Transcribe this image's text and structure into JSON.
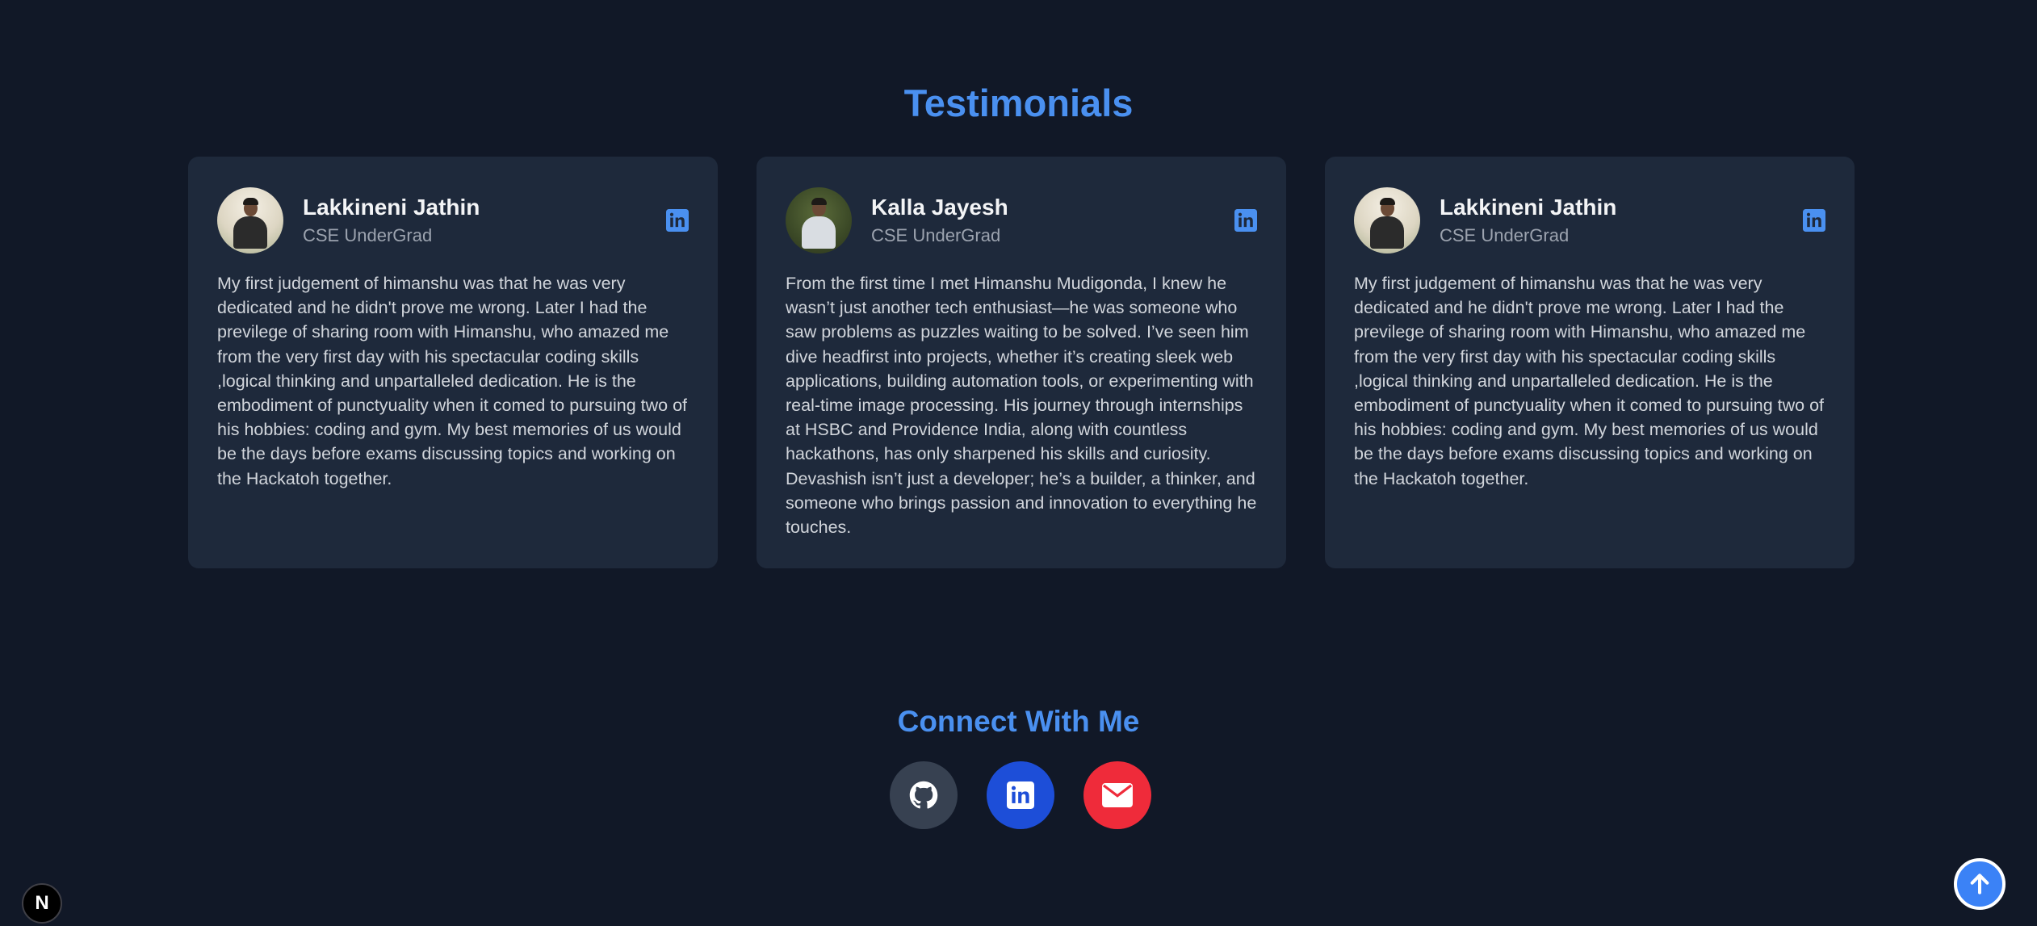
{
  "testimonials": {
    "title": "Testimonials",
    "cards": [
      {
        "name": "Lakkineni Jathin",
        "role": "CSE UnderGrad",
        "icon": "linkedin-icon",
        "text": "My first judgement of himanshu was that he was very dedicated and he didn't prove me wrong. Later I had the previlege of sharing room with Himanshu, who amazed me from the very first day with his spectacular coding skills ,logical thinking and unpartalleled dedication. He is the embodiment of punctyuality when it comed to pursuing two of his hobbies: coding and gym. My best memories of us would be the days before exams discussing topics and working on the Hackatoh together."
      },
      {
        "name": "Kalla Jayesh",
        "role": "CSE UnderGrad",
        "icon": "linkedin-icon",
        "text": "From the first time I met Himanshu Mudigonda, I knew he wasn’t just another tech enthusiast—he was someone who saw problems as puzzles waiting to be solved. I’ve seen him dive headfirst into projects, whether it’s creating sleek web applications, building automation tools, or experimenting with real-time image processing. His journey through internships at HSBC and Providence India, along with countless hackathons, has only sharpened his skills and curiosity. Devashish isn’t just a developer; he’s a builder, a thinker, and someone who brings passion and innovation to everything he touches."
      },
      {
        "name": "Lakkineni Jathin",
        "role": "CSE UnderGrad",
        "icon": "linkedin-icon",
        "text": "My first judgement of himanshu was that he was very dedicated and he didn't prove me wrong. Later I had the previlege of sharing room with Himanshu, who amazed me from the very first day with his spectacular coding skills ,logical thinking and unpartalleled dedication. He is the embodiment of punctyuality when it comed to pursuing two of his hobbies: coding and gym. My best memories of us would be the days before exams discussing topics and working on the Hackatoh together."
      }
    ]
  },
  "connect": {
    "title": "Connect With Me",
    "buttons": [
      {
        "icon": "github-icon",
        "color": "#374151"
      },
      {
        "icon": "linkedin-icon",
        "color": "#1d4ed8"
      },
      {
        "icon": "mail-icon",
        "color": "#ef2b3a"
      }
    ]
  },
  "badges": {
    "next_letter": "N",
    "scroll_top_icon": "arrow-up-icon"
  },
  "colors": {
    "background": "#111827",
    "card": "#1e293b",
    "accent": "#4a90f0"
  }
}
